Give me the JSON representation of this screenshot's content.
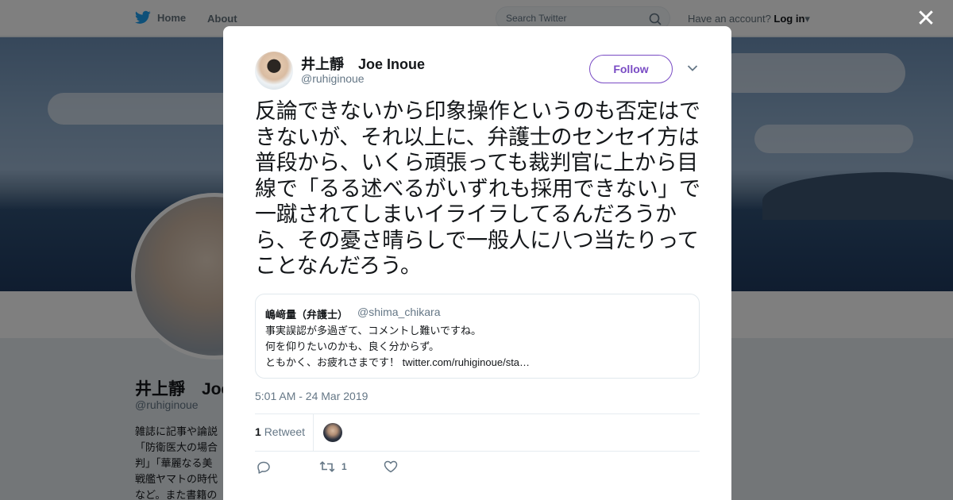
{
  "topbar": {
    "home_label": "Home",
    "about_label": "About",
    "search_placeholder": "Search Twitter",
    "account_prompt": "Have an account?",
    "login_label": "Log in"
  },
  "profile": {
    "name": "井上靜　Joe",
    "handle": "@ruhiginoue",
    "bio": "雑誌に記事や論説\n「防衛医大の場合\n判」「華麗なる美\n戦艦ヤマトの時代\nなど。また書籍の"
  },
  "tweet": {
    "author_name": "井上靜　Joe Inoue",
    "author_handle": "@ruhiginoue",
    "follow_label": "Follow",
    "text": "反論できないから印象操作というのも否定はできないが、それ以上に、弁護士のセンセイ方は普段から、いくら頑張っても裁判官に上から目線で「るる述べるがいずれも採用できない」で一蹴されてしまいイライラしてるんだろうから、その憂さ晴らしで一般人に八つ当たりってことなんだろう。",
    "quote": {
      "name": "嶋﨑量（弁護士）",
      "handle": "@shima_chikara",
      "line1": "事実誤認が多過ぎて、コメントし難いですね。",
      "line2": "何を仰りたいのかも、良く分からず。",
      "line3_prefix": "ともかく、お疲れさまです！ ",
      "link": "twitter.com/ruhiginoue/sta…"
    },
    "timestamp": "5:01 AM - 24 Mar 2019",
    "retweet_count": "1",
    "retweet_label": "Retweet",
    "action_retweet_count": "1"
  },
  "icons": {
    "bird": "twitter-bird-icon",
    "search": "search-icon",
    "close": "close-icon",
    "caret": "chevron-down-icon",
    "reply": "reply-icon",
    "retweet": "retweet-icon",
    "like": "heart-icon"
  },
  "colors": {
    "accent": "#794bc4",
    "twitter_blue": "#1da1f2",
    "secondary_text": "#657786"
  }
}
